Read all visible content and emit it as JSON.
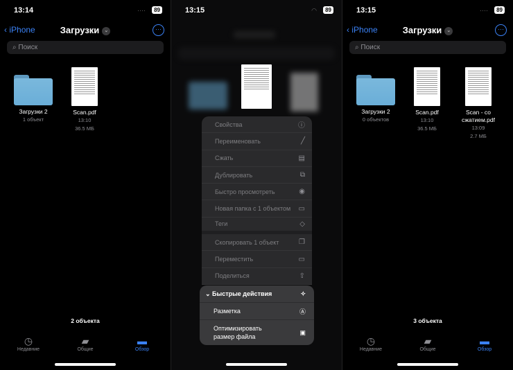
{
  "screens": [
    {
      "time": "13:14",
      "battery": "89",
      "back": "iPhone",
      "title": "Загрузки",
      "search_placeholder": "Поиск",
      "items": [
        {
          "type": "folder",
          "name": "Загрузки 2",
          "meta1": "1 объект",
          "meta2": ""
        },
        {
          "type": "pdf",
          "name": "Scan.pdf",
          "meta1": "13:10",
          "meta2": "36.5 МБ"
        }
      ],
      "count": "2 объекта"
    },
    {
      "time": "13:15",
      "battery": "89",
      "menu": [
        {
          "label": "Свойства",
          "icon": "info-icon",
          "glyph": "ⓘ"
        },
        {
          "label": "Переименовать",
          "icon": "pencil-icon",
          "glyph": "╱"
        },
        {
          "label": "Сжать",
          "icon": "archive-icon",
          "glyph": "▤"
        },
        {
          "label": "Дублировать",
          "icon": "duplicate-icon",
          "glyph": "⧉"
        },
        {
          "label": "Быстро просмотреть",
          "icon": "eye-icon",
          "glyph": "◉"
        },
        {
          "label": "Новая папка с 1 объектом",
          "icon": "folder-badge-plus-icon",
          "glyph": "▭"
        },
        {
          "label": "Теги",
          "icon": "tag-icon",
          "glyph": "◇"
        },
        {
          "label": "Скопировать 1 объект",
          "icon": "copy-icon",
          "glyph": "❐"
        },
        {
          "label": "Переместить",
          "icon": "folder-icon",
          "glyph": "▭"
        },
        {
          "label": "Поделиться",
          "icon": "share-icon",
          "glyph": "⇧"
        }
      ],
      "quick_actions": {
        "header": "Быстрые действия",
        "header_icon": "sparkles-icon",
        "header_glyph": "✧",
        "items": [
          {
            "label": "Разметка",
            "icon": "markup-icon",
            "glyph": "Ⓐ"
          },
          {
            "label": "Оптимизировать размер файла",
            "icon": "compress-doc-icon",
            "glyph": "▣"
          }
        ]
      }
    },
    {
      "time": "13:15",
      "battery": "89",
      "back": "iPhone",
      "title": "Загрузки",
      "search_placeholder": "Поиск",
      "items": [
        {
          "type": "folder",
          "name": "Загрузки 2",
          "meta1": "0 объектов",
          "meta2": ""
        },
        {
          "type": "pdf",
          "name": "Scan.pdf",
          "meta1": "13:10",
          "meta2": "36.5 МБ"
        },
        {
          "type": "pdf",
          "name": "Scan - со сжатием.pdf",
          "meta1": "13:09",
          "meta2": "2.7 МБ"
        }
      ],
      "count": "3 объекта"
    }
  ],
  "tabs": [
    {
      "label": "Недавние",
      "icon": "clock-icon"
    },
    {
      "label": "Общие",
      "icon": "shared-folder-icon"
    },
    {
      "label": "Обзор",
      "icon": "folder-icon",
      "active": true
    }
  ],
  "colors": {
    "accent": "#3b82f6",
    "folder": "#6aaed8"
  }
}
